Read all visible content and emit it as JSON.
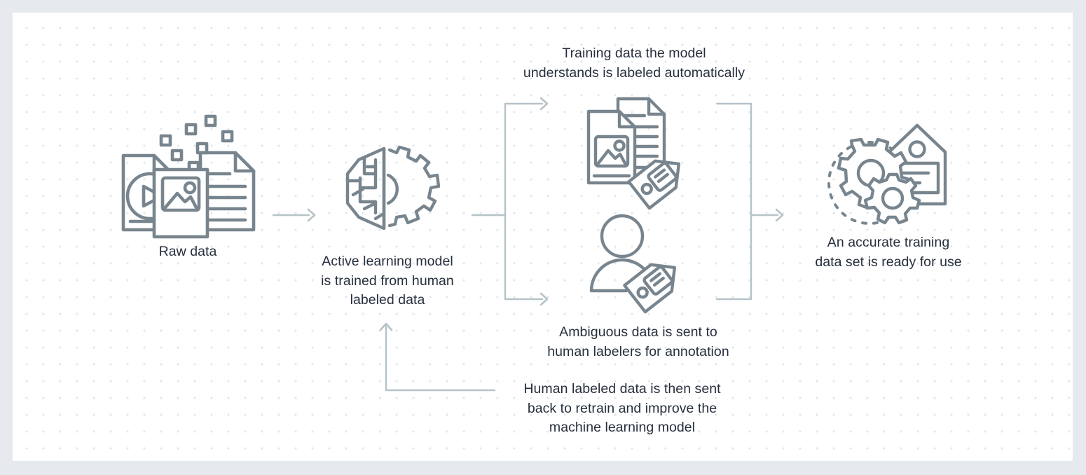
{
  "canvas": {
    "background_color": "#e6eaee",
    "card_color": "#ffffff",
    "dot_color": "#e3e7ea",
    "icon_stroke_color": "#78858e",
    "connector_color": "#b6c3c8",
    "text_color": "#262f3d"
  },
  "nodes": {
    "raw_data": {
      "caption": "Raw data",
      "icon": "documents-media-icon"
    },
    "active_learning_model": {
      "caption": "Active learning model\nis trained from human\nlabeled data",
      "icon": "brain-gear-icon"
    },
    "auto_labeled": {
      "caption": "Training data the model\nunderstands is labeled automatically",
      "icon": "labeled-documents-icon"
    },
    "human_labelers": {
      "caption": "Ambiguous data is sent to\nhuman labelers for annotation",
      "icon": "person-tag-icon"
    },
    "feedback": {
      "caption": "Human labeled data is then sent\nback to retrain and improve the\nmachine learning model"
    },
    "training_set": {
      "caption": "An accurate training\ndata set is ready for use",
      "icon": "gears-tag-icon"
    }
  },
  "connectors": [
    {
      "name": "raw-to-model-arrow",
      "type": "arrow-right"
    },
    {
      "name": "model-to-split-line",
      "type": "line"
    },
    {
      "name": "split-bracket-top-arrow",
      "type": "arrow-right"
    },
    {
      "name": "split-bracket-bottom-arrow",
      "type": "arrow-right"
    },
    {
      "name": "merge-bracket-arrow",
      "type": "arrow-right"
    },
    {
      "name": "feedback-loop-arrow",
      "type": "arrow-up"
    }
  ]
}
